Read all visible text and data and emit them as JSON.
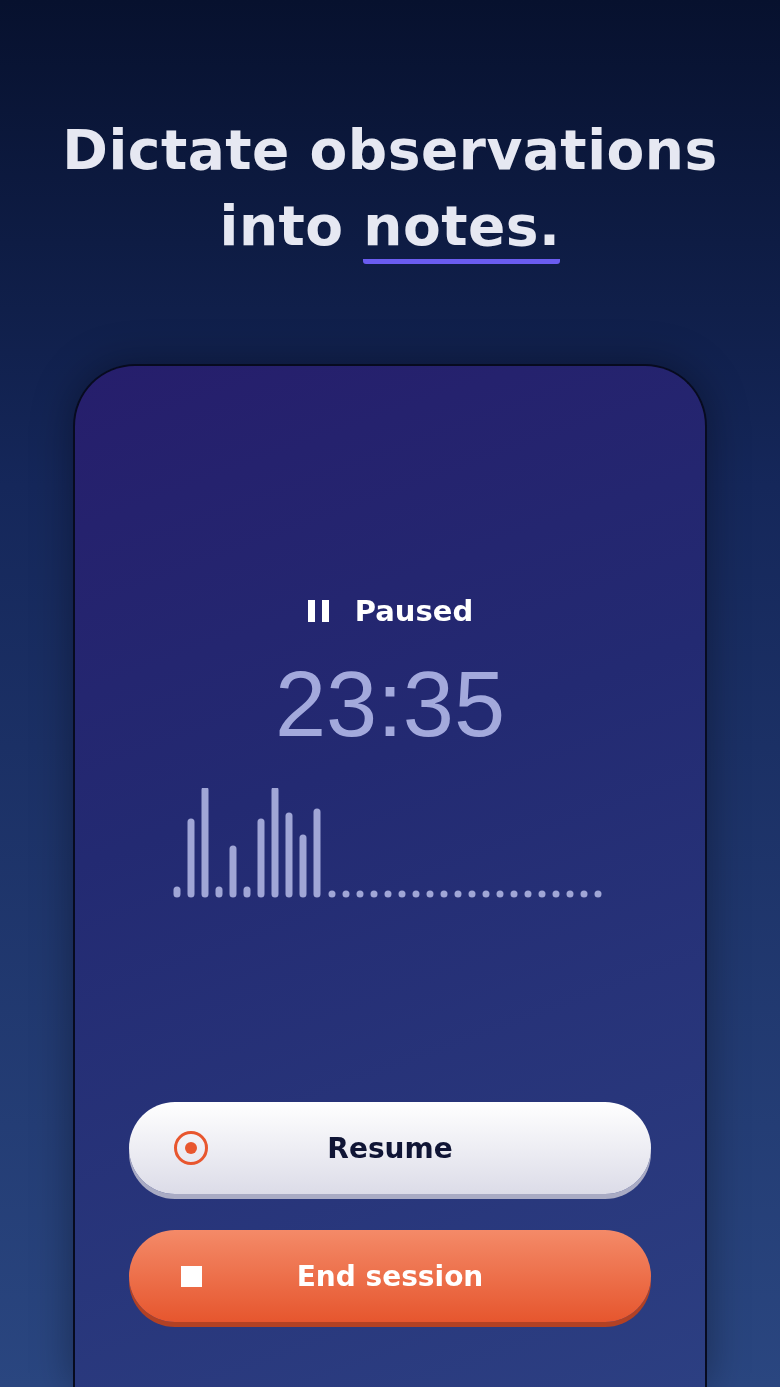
{
  "headline": {
    "text": "Dictate observations into",
    "highlight": "notes."
  },
  "status": {
    "label": "Paused",
    "paused": true
  },
  "timer": "23:35",
  "buttons": [
    {
      "kind": "resume",
      "label": "Resume"
    },
    {
      "kind": "end",
      "label": "End session"
    }
  ]
}
